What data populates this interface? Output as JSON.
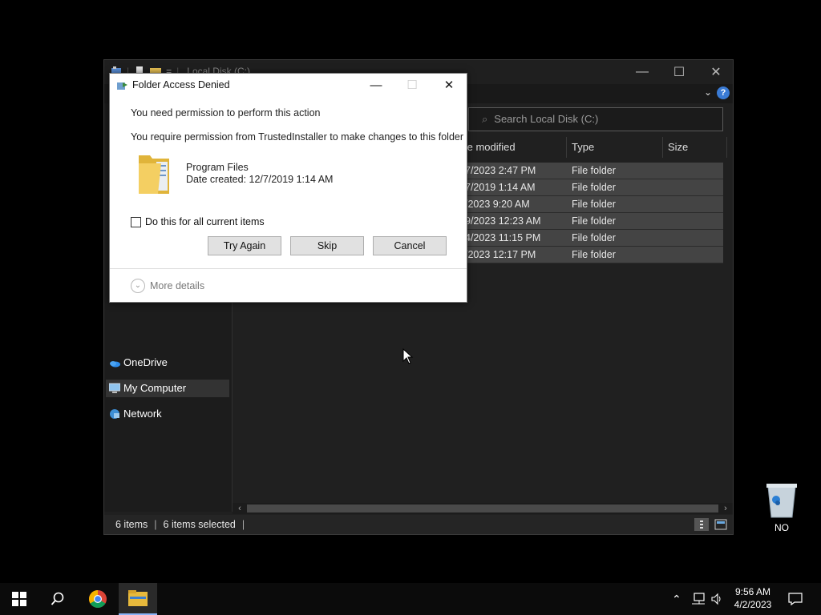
{
  "explorer": {
    "title": "Local Disk (C:)",
    "search_placeholder": "Search Local Disk (C:)",
    "columns": {
      "date": "te modified",
      "type": "Type",
      "size": "Size"
    },
    "rows": [
      {
        "date": "7/2023 2:47 PM",
        "type": "File folder"
      },
      {
        "date": "7/2019 1:14 AM",
        "type": "File folder"
      },
      {
        "date": "/2023 9:20 AM",
        "type": "File folder"
      },
      {
        "date": "9/2023 12:23 AM",
        "type": "File folder"
      },
      {
        "date": "4/2023 11:15 PM",
        "type": "File folder"
      },
      {
        "date": "/2023 12:17 PM",
        "type": "File folder"
      }
    ],
    "nav": {
      "onedrive": "OneDrive",
      "my_computer": "My Computer",
      "network": "Network"
    },
    "status": {
      "count": "6 items",
      "selected": "6 items selected"
    },
    "help_label": "?"
  },
  "dialog": {
    "title": "Folder Access Denied",
    "message1": "You need permission to perform this action",
    "message2": "You require permission from TrustedInstaller to make changes to this folder",
    "folder_name": "Program Files",
    "date_created": "Date created: 12/7/2019 1:14 AM",
    "checkbox_label": "Do this for all current items",
    "buttons": {
      "try_again": "Try Again",
      "skip": "Skip",
      "cancel": "Cancel"
    },
    "more_details": "More details"
  },
  "desktop": {
    "recycle_label": "NO"
  },
  "taskbar": {
    "time": "9:56 AM",
    "date": "4/2/2023"
  },
  "colors": {
    "accent": "#3a7bd5",
    "selected_row": "#444444",
    "window_bg": "#202020"
  }
}
